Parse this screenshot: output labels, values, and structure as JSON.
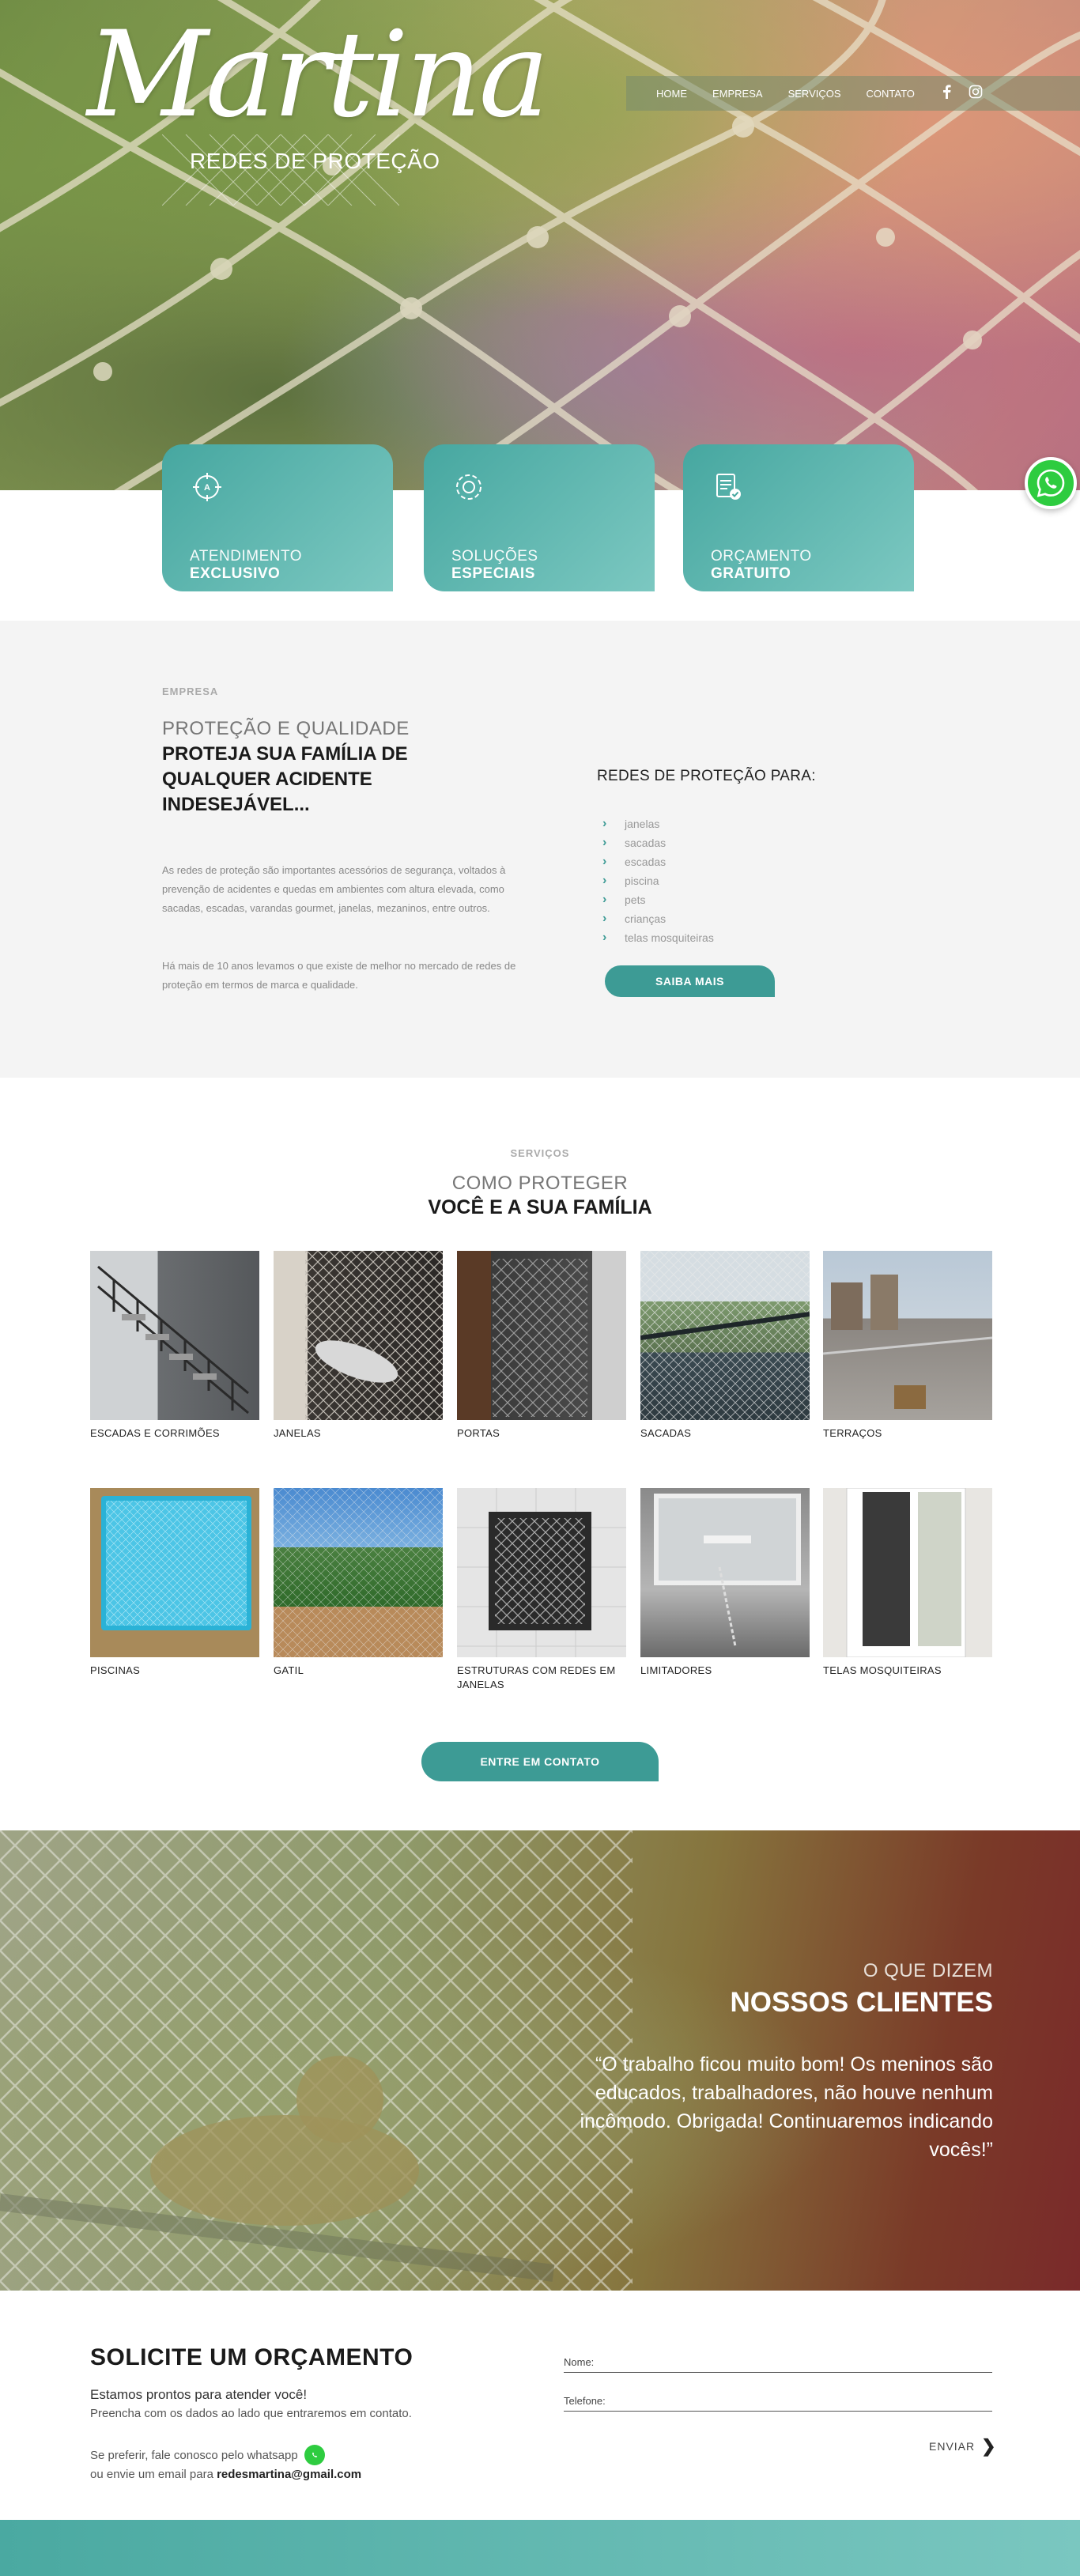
{
  "brand": {
    "logo_script": "Martina",
    "logo_sub": "REDES DE PROTEÇÃO"
  },
  "nav": {
    "items": [
      "HOME",
      "EMPRESA",
      "SERVIÇOS",
      "CONTATO"
    ],
    "social": [
      "facebook-icon",
      "instagram-icon"
    ]
  },
  "features": [
    {
      "line1": "ATENDIMENTO",
      "line2": "EXCLUSIVO",
      "icon": "target-icon"
    },
    {
      "line1": "SOLUÇÕES",
      "line2": "ESPECIAIS",
      "icon": "gear-icon"
    },
    {
      "line1": "ORÇAMENTO",
      "line2": "GRATUITO",
      "icon": "document-check-icon"
    }
  ],
  "empresa": {
    "kicker": "EMPRESA",
    "title_light": "PROTEÇÃO E QUALIDADE",
    "title_bold": "PROTEJA SUA FAMÍLIA DE QUALQUER ACIDENTE INDESEJÁVEL...",
    "p1": "As redes de proteção são importantes acessórios de segurança, voltados à prevenção de acidentes e quedas em ambientes com altura elevada, como sacadas, escadas, varandas gourmet, janelas, mezaninos, entre outros.",
    "p2": "Há mais de 10 anos levamos o que existe de melhor no mercado de redes de proteção em termos de marca e qualidade.",
    "list_title": "REDES DE PROTEÇÃO PARA:",
    "list": [
      "janelas",
      "sacadas",
      "escadas",
      "piscina",
      "pets",
      "crianças",
      "telas mosquiteiras"
    ],
    "button": "SAIBA MAIS"
  },
  "servicos": {
    "kicker": "SERVIÇOS",
    "title_light": "COMO PROTEGER",
    "title_bold": "VOCÊ E A SUA FAMÍLIA",
    "items": [
      {
        "caption": "ESCADAS E CORRIMÕES"
      },
      {
        "caption": "JANELAS"
      },
      {
        "caption": "PORTAS"
      },
      {
        "caption": "SACADAS"
      },
      {
        "caption": "TERRAÇOS"
      },
      {
        "caption": "PISCINAS"
      },
      {
        "caption": "GATIL"
      },
      {
        "caption": "ESTRUTURAS COM REDES EM JANELAS"
      },
      {
        "caption": "LIMITADORES"
      },
      {
        "caption": "TELAS MOSQUITEIRAS"
      }
    ],
    "button": "ENTRE EM CONTATO"
  },
  "testimonial": {
    "title_light": "O QUE DIZEM",
    "title_bold": "NOSSOS CLIENTES",
    "quote": "“O trabalho ficou muito bom! Os meninos são educados, trabalhadores, não houve nenhum incômodo. Obrigada! Continuaremos indicando vocês!”"
  },
  "contact": {
    "title": "SOLICITE UM ORÇAMENTO",
    "line1": "Estamos prontos para atender você!",
    "line2": "Preencha com os dados ao lado que entraremos em contato.",
    "line3": "Se preferir, fale conosco pelo whatsapp",
    "line4_prefix": "ou envie um email para",
    "email": "redesmartina@gmail.com",
    "name_label": "Nome:",
    "phone_label": "Telefone:",
    "submit": "ENVIAR"
  },
  "colors": {
    "teal": "#3d9b95",
    "teal_light": "#7cc8c1",
    "whatsapp": "#2ecc40",
    "section_gray": "#f4f4f4"
  }
}
